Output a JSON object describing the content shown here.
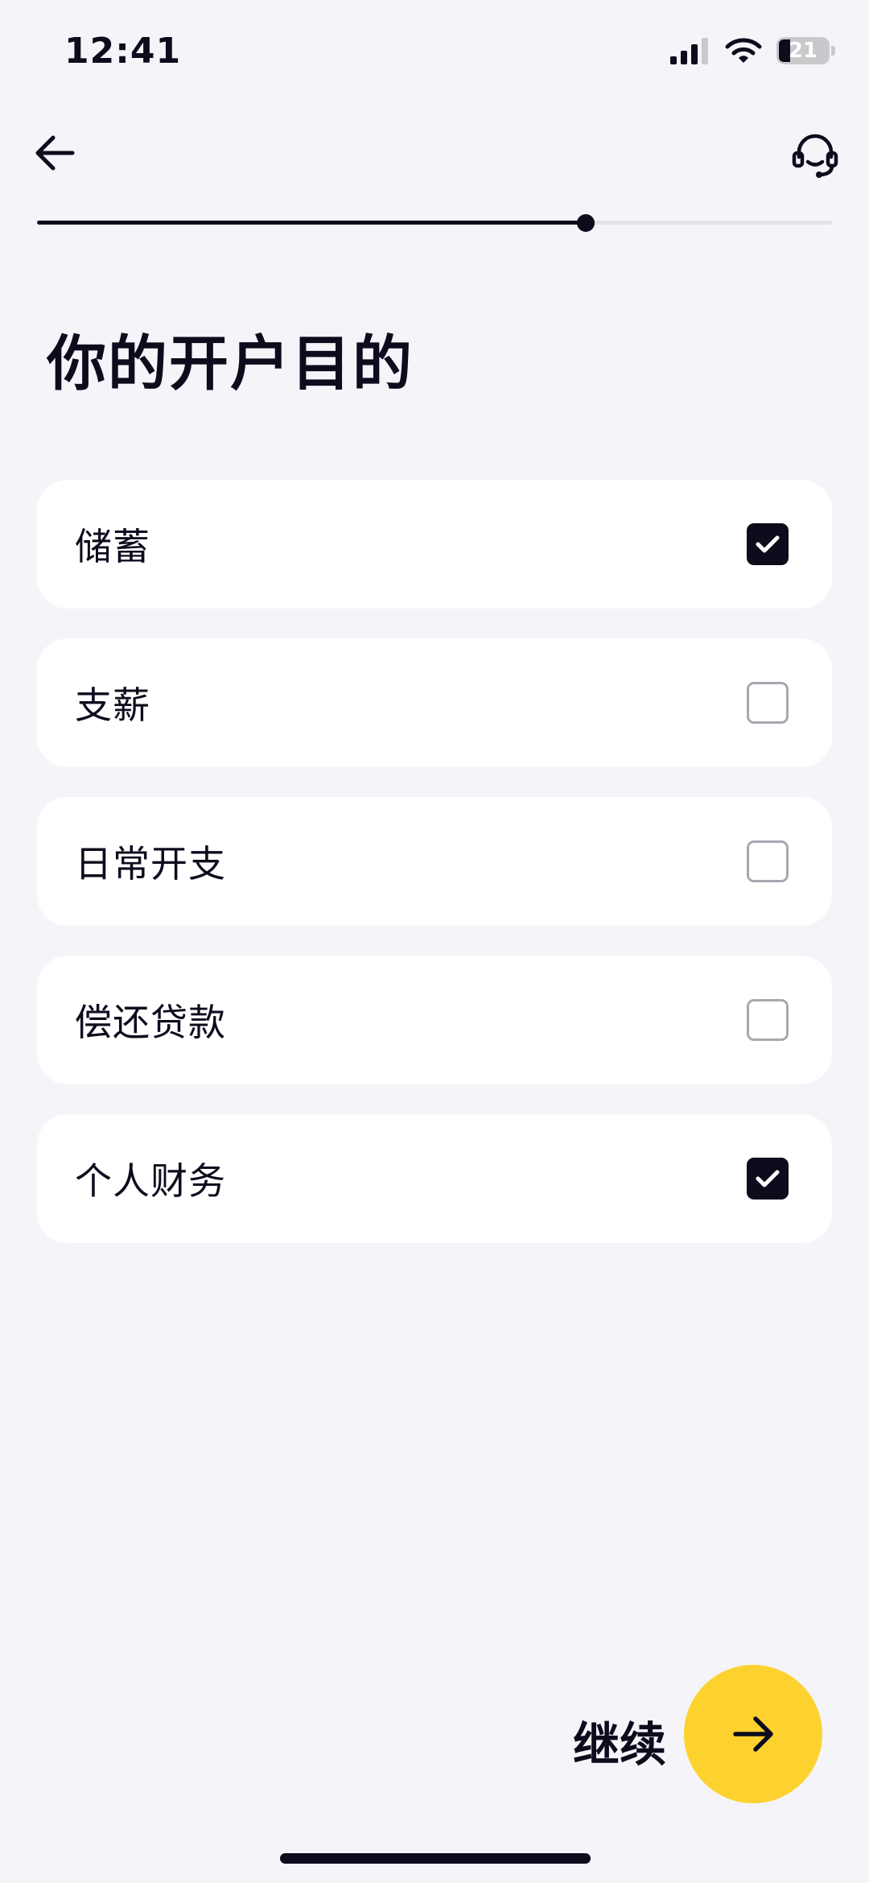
{
  "status_bar": {
    "time": "12:41",
    "battery_level": "21",
    "icons": [
      "signal-icon",
      "wifi-icon",
      "battery-icon"
    ]
  },
  "header": {
    "back_icon": "arrow-left-icon",
    "support_icon": "headset-icon"
  },
  "progress": {
    "fraction": 0.69
  },
  "page": {
    "title": "你的开户目的"
  },
  "options": [
    {
      "label": "储蓄",
      "checked": true
    },
    {
      "label": "支薪",
      "checked": false
    },
    {
      "label": "日常开支",
      "checked": false
    },
    {
      "label": "偿还贷款",
      "checked": false
    },
    {
      "label": "个人财务",
      "checked": true
    }
  ],
  "footer": {
    "continue_label": "继续",
    "continue_icon": "arrow-right-icon"
  },
  "colors": {
    "background": "#f4f4f9",
    "text": "#0c0c1d",
    "accent": "#fdd22f",
    "card": "#ffffff"
  }
}
